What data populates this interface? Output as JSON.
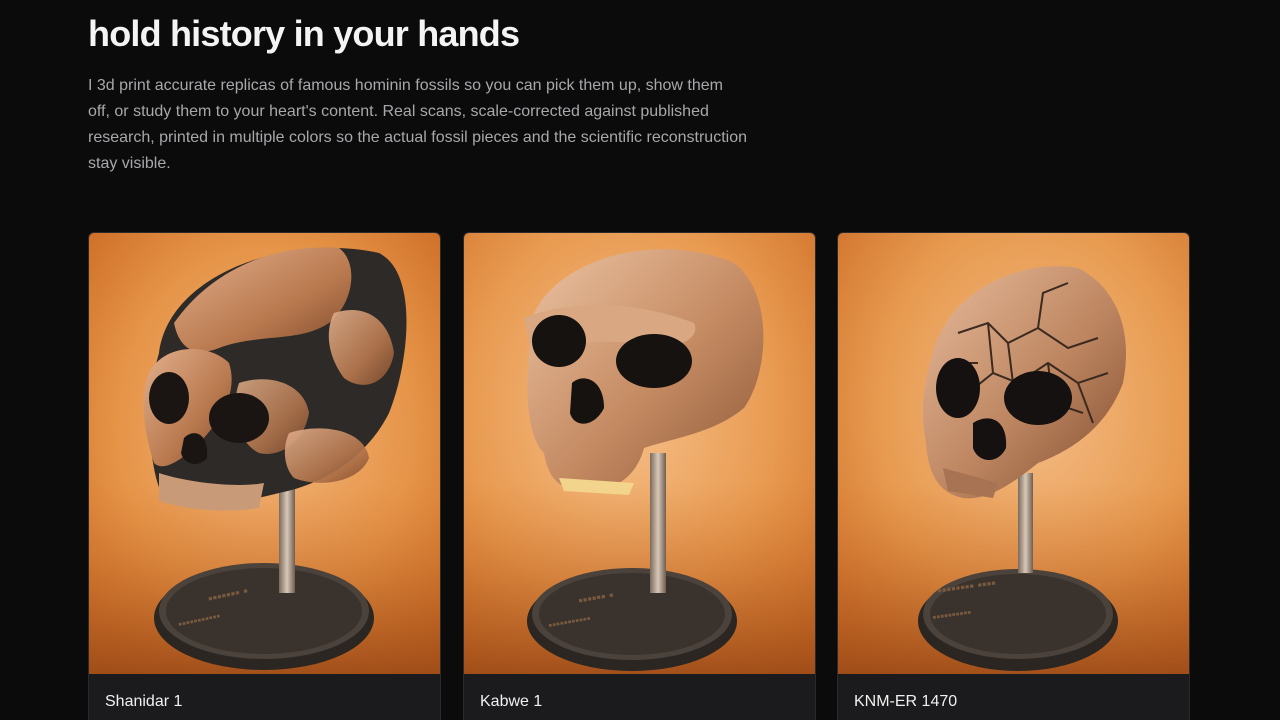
{
  "hero": {
    "title": "hold history in your hands",
    "description": "I 3d print accurate replicas of famous hominin fossils so you can pick them up, show them off, or study them to your heart's content. Real scans, scale-corrected against published research, printed in multiple colors so the actual fossil pieces and the scientific reconstruction stay visible."
  },
  "products": [
    {
      "name": "Shanidar 1"
    },
    {
      "name": "Kabwe 1"
    },
    {
      "name": "KNM-ER 1470"
    }
  ],
  "colors": {
    "background": "#0b0b0c",
    "card": "#1b1b1d",
    "copper": "#b87a52",
    "orange_backdrop": "#e08a3c"
  }
}
